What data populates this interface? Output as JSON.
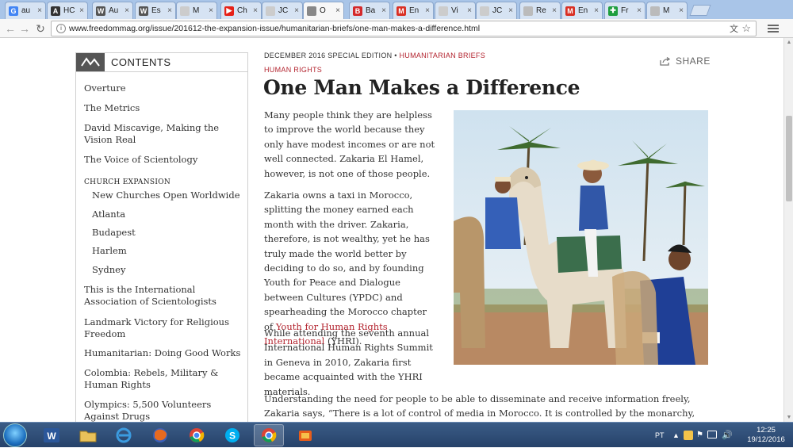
{
  "browser": {
    "tabs": [
      {
        "title": "au",
        "favicon": "G",
        "color": "#4285f4"
      },
      {
        "title": "HC",
        "favicon": "A",
        "color": "#333333"
      },
      {
        "title": "Au",
        "favicon": "W",
        "color": "#555555"
      },
      {
        "title": "Es",
        "favicon": "W",
        "color": "#555555"
      },
      {
        "title": "M",
        "favicon": "",
        "color": "#cccccc"
      },
      {
        "title": "Ch",
        "favicon": "▶",
        "color": "#e62117"
      },
      {
        "title": "JC",
        "favicon": "",
        "color": "#cccccc"
      },
      {
        "title": "O",
        "favicon": "",
        "color": "#888888"
      },
      {
        "title": "Ba",
        "favicon": "B",
        "color": "#d4292b"
      },
      {
        "title": "En",
        "favicon": "M",
        "color": "#d93025"
      },
      {
        "title": "Vi",
        "favicon": "",
        "color": "#cccccc"
      },
      {
        "title": "JC",
        "favicon": "",
        "color": "#cccccc"
      },
      {
        "title": "Re",
        "favicon": "",
        "color": "#bbbbbb"
      },
      {
        "title": "En",
        "favicon": "M",
        "color": "#d93025"
      },
      {
        "title": "Fr",
        "favicon": "✚",
        "color": "#1e9e3e"
      },
      {
        "title": "M",
        "favicon": "",
        "color": "#bbbbbb"
      }
    ],
    "url": "www.freedommag.org/issue/201612-the-expansion-issue/humanitarian-briefs/one-man-makes-a-difference.html"
  },
  "sidebar": {
    "title": "CONTENTS",
    "items": [
      {
        "label": "Overture"
      },
      {
        "label": "The Metrics"
      },
      {
        "label": "David Miscavige, Making the Vision Real"
      },
      {
        "label": "The Voice of Scientology"
      }
    ],
    "section_heading": "CHURCH EXPANSION",
    "sub_items": [
      {
        "label": "New Churches Open Worldwide"
      },
      {
        "label": "Atlanta"
      },
      {
        "label": "Budapest"
      },
      {
        "label": "Harlem"
      },
      {
        "label": "Sydney"
      }
    ],
    "more_items": [
      {
        "label": "This is the International Association of Scientologists"
      },
      {
        "label": "Landmark Victory for Religious Freedom"
      },
      {
        "label": "Humanitarian: Doing Good Works"
      },
      {
        "label": "Colombia: Rebels, Military & Human Rights"
      },
      {
        "label": "Olympics: 5,500 Volunteers Against Drugs"
      }
    ]
  },
  "article": {
    "edition": "DECEMBER 2016 SPECIAL EDITION",
    "separator": " • ",
    "section": "HUMANITARIAN BRIEFS",
    "tag": "HUMAN RIGHTS",
    "share_label": "SHARE",
    "title": "One Man Makes a Difference",
    "p1": "Many people think they are helpless to improve the world because they only have modest incomes or are not well connected. Zakaria El Hamel, however, is not one of those people.",
    "p2_before": "Zakaria owns a taxi in Morocco, splitting the money earned each month with the driver. Zakaria, therefore, is not wealthy, yet he has truly made the world better by deciding to do so, and by founding Youth for Peace and Dialogue between Cultures (YPDC) and spearheading the Morocco chapter of ",
    "p2_link": "Youth for Human Rights International",
    "p2_after": " (YHRI).",
    "p3": "While attending the seventh annual International Human Rights Summit in Geneva in 2010, Zakaria first became acquainted with the YHRI materials.",
    "p4": "Understanding the need for people to be able to disseminate and receive information freely, Zakaria says, “There is a lot of control of media in Morocco. It is controlled by the monarchy, and only what"
  },
  "taskbar": {
    "language": "PT",
    "time": "12:25",
    "date": "19/12/2016"
  },
  "colors": {
    "accent_red": "#b3242f",
    "text": "#333333"
  }
}
